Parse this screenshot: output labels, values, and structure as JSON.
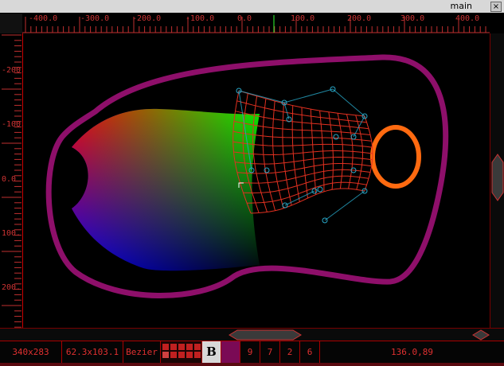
{
  "window": {
    "title": "main",
    "close_glyph": "×"
  },
  "ruler_h": {
    "labels": [
      "-400.0",
      "-300.0",
      "-200.0",
      "-100.0",
      "0.0",
      "100.0",
      "200.0",
      "300.0",
      "400.0"
    ]
  },
  "ruler_v": {
    "labels": [
      "-200.",
      "-100.",
      "0.0",
      "100.",
      "200."
    ]
  },
  "status": {
    "size": "340x283",
    "dimensions": "62.3x103.1",
    "mode": "Bezier",
    "bold_glyph": "B",
    "counts": [
      "9",
      "7",
      "2",
      "6"
    ],
    "coords": "136.0,89"
  },
  "colors": {
    "accent": "#cc2020",
    "outline_purple": "#8e0f6a",
    "ellipse_orange": "#ff6a10",
    "mesh_red": "#e03020",
    "handle_cyan": "#28a8c8",
    "swatch_purple": "#7a0a55"
  }
}
